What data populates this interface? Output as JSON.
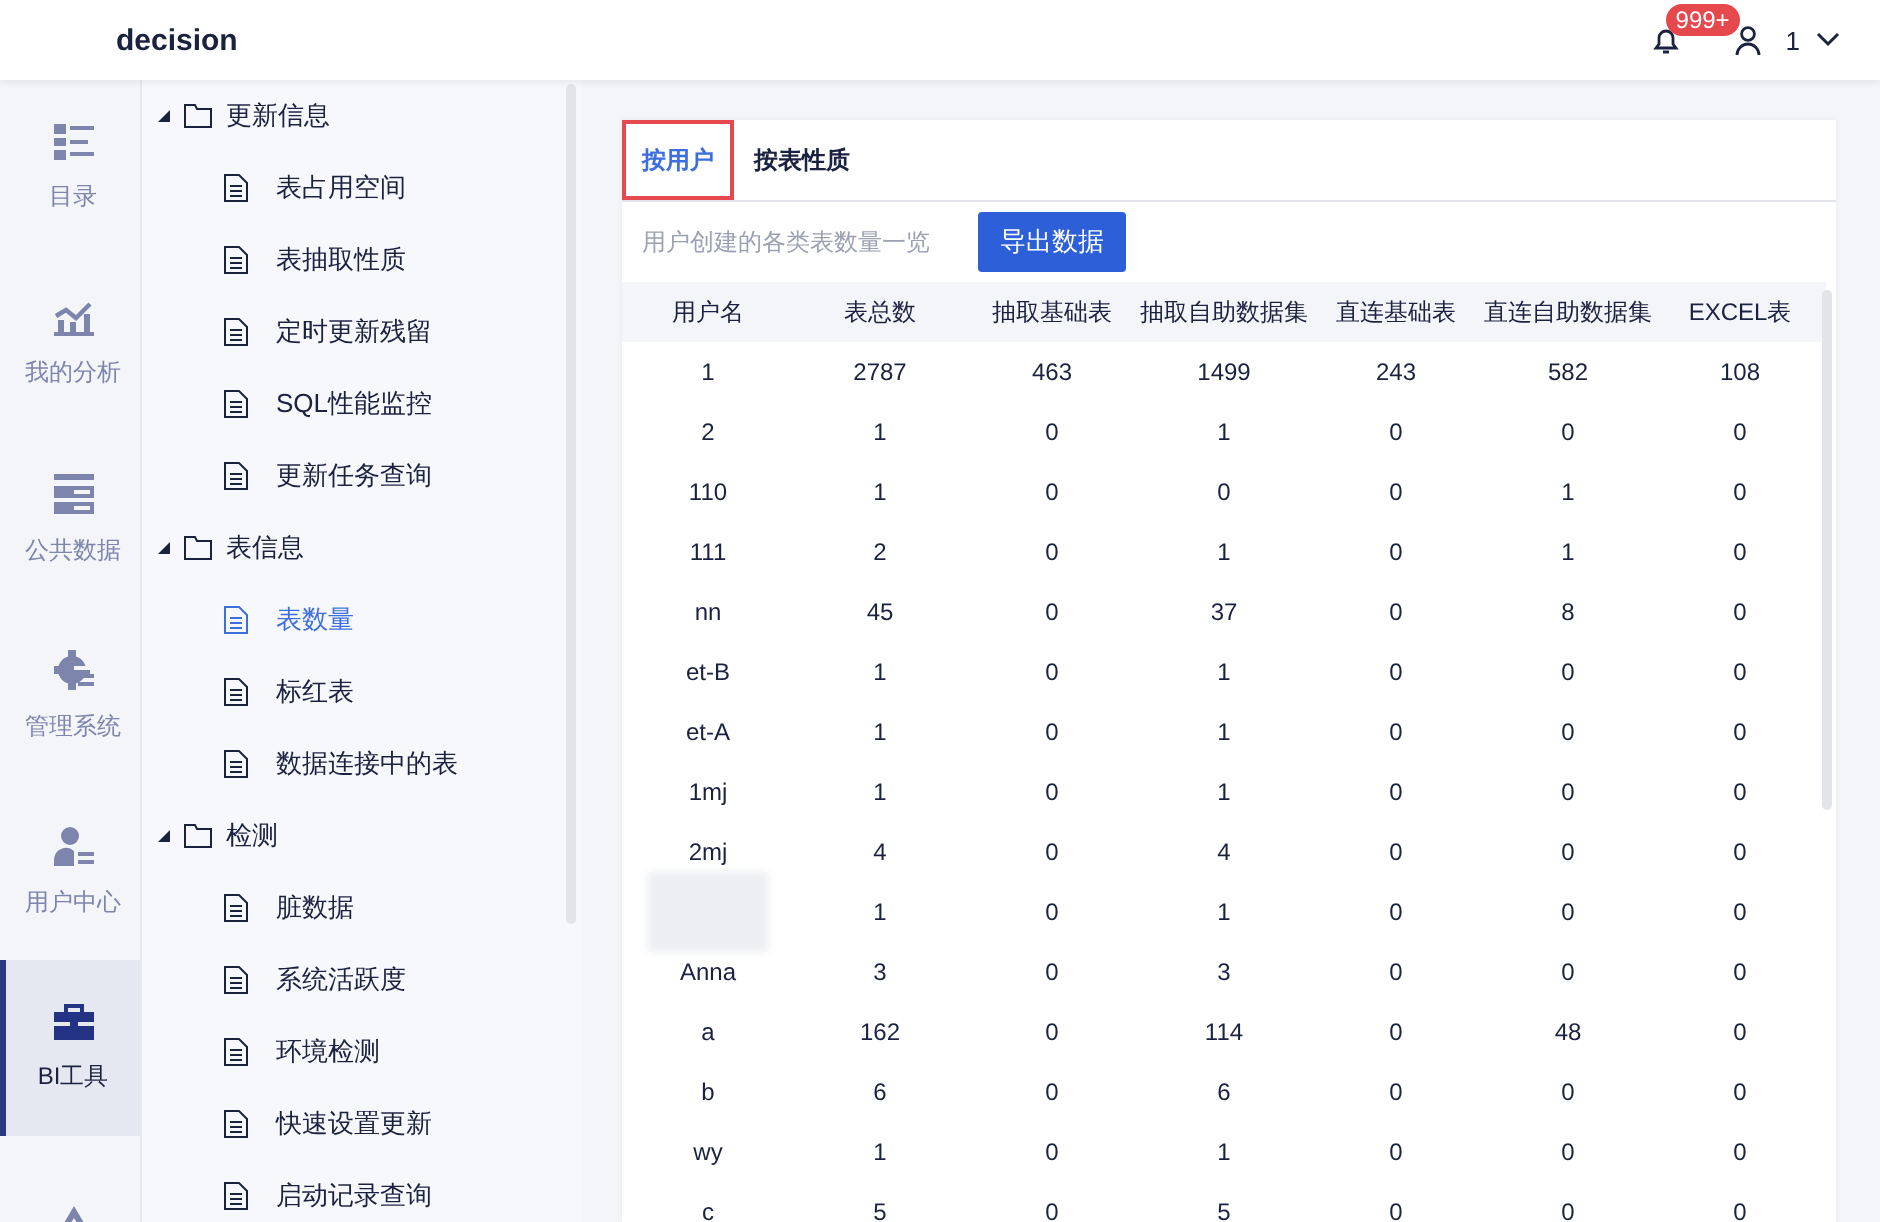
{
  "header": {
    "title": "decision",
    "notification_count": "999+",
    "user": "1"
  },
  "rail": [
    {
      "label": "目录",
      "selected": false
    },
    {
      "label": "我的分析",
      "selected": false
    },
    {
      "label": "公共数据",
      "selected": false
    },
    {
      "label": "管理系统",
      "selected": false
    },
    {
      "label": "用户中心",
      "selected": false
    },
    {
      "label": "BI工具",
      "selected": true
    },
    {
      "selected": false
    }
  ],
  "tree": [
    {
      "label": "更新信息",
      "expanded": true,
      "children": [
        {
          "label": "表占用空间",
          "selected": false
        },
        {
          "label": "表抽取性质",
          "selected": false
        },
        {
          "label": "定时更新残留",
          "selected": false
        },
        {
          "label": "SQL性能监控",
          "selected": false
        },
        {
          "label": "更新任务查询",
          "selected": false
        }
      ]
    },
    {
      "label": "表信息",
      "expanded": true,
      "children": [
        {
          "label": "表数量",
          "selected": true
        },
        {
          "label": "标红表",
          "selected": false
        },
        {
          "label": "数据连接中的表",
          "selected": false
        }
      ]
    },
    {
      "label": "检测",
      "expanded": true,
      "children": [
        {
          "label": "脏数据",
          "selected": false
        },
        {
          "label": "系统活跃度",
          "selected": false
        },
        {
          "label": "环境检测",
          "selected": false
        },
        {
          "label": "快速设置更新",
          "selected": false
        },
        {
          "label": "启动记录查询",
          "selected": false
        }
      ]
    }
  ],
  "tabs": [
    {
      "label": "按用户",
      "selected": true,
      "highlighted": true
    },
    {
      "label": "按表性质",
      "selected": false,
      "highlighted": false
    }
  ],
  "description": "用户创建的各类表数量一览",
  "export_button": "导出数据",
  "table": {
    "columns": [
      "用户名",
      "表总数",
      "抽取基础表",
      "抽取自助数据集",
      "直连基础表",
      "直连自助数据集",
      "EXCEL表"
    ],
    "rows": [
      [
        "1",
        "2787",
        "463",
        "1499",
        "243",
        "582",
        "108"
      ],
      [
        "2",
        "1",
        "0",
        "1",
        "0",
        "0",
        "0"
      ],
      [
        "110",
        "1",
        "0",
        "0",
        "0",
        "1",
        "0"
      ],
      [
        "111",
        "2",
        "0",
        "1",
        "0",
        "1",
        "0"
      ],
      [
        "nn",
        "45",
        "0",
        "37",
        "0",
        "8",
        "0"
      ],
      [
        "et-B",
        "1",
        "0",
        "1",
        "0",
        "0",
        "0"
      ],
      [
        "et-A",
        "1",
        "0",
        "1",
        "0",
        "0",
        "0"
      ],
      [
        "1mj",
        "1",
        "0",
        "1",
        "0",
        "0",
        "0"
      ],
      [
        "2mj",
        "4",
        "0",
        "4",
        "0",
        "0",
        "0"
      ],
      [
        "",
        "1",
        "0",
        "1",
        "0",
        "0",
        "0"
      ],
      [
        "Anna",
        "3",
        "0",
        "3",
        "0",
        "0",
        "0"
      ],
      [
        "a",
        "162",
        "0",
        "114",
        "0",
        "48",
        "0"
      ],
      [
        "b",
        "6",
        "0",
        "6",
        "0",
        "0",
        "0"
      ],
      [
        "wy",
        "1",
        "0",
        "1",
        "0",
        "0",
        "0"
      ],
      [
        "c",
        "5",
        "0",
        "5",
        "0",
        "0",
        "0"
      ]
    ]
  }
}
